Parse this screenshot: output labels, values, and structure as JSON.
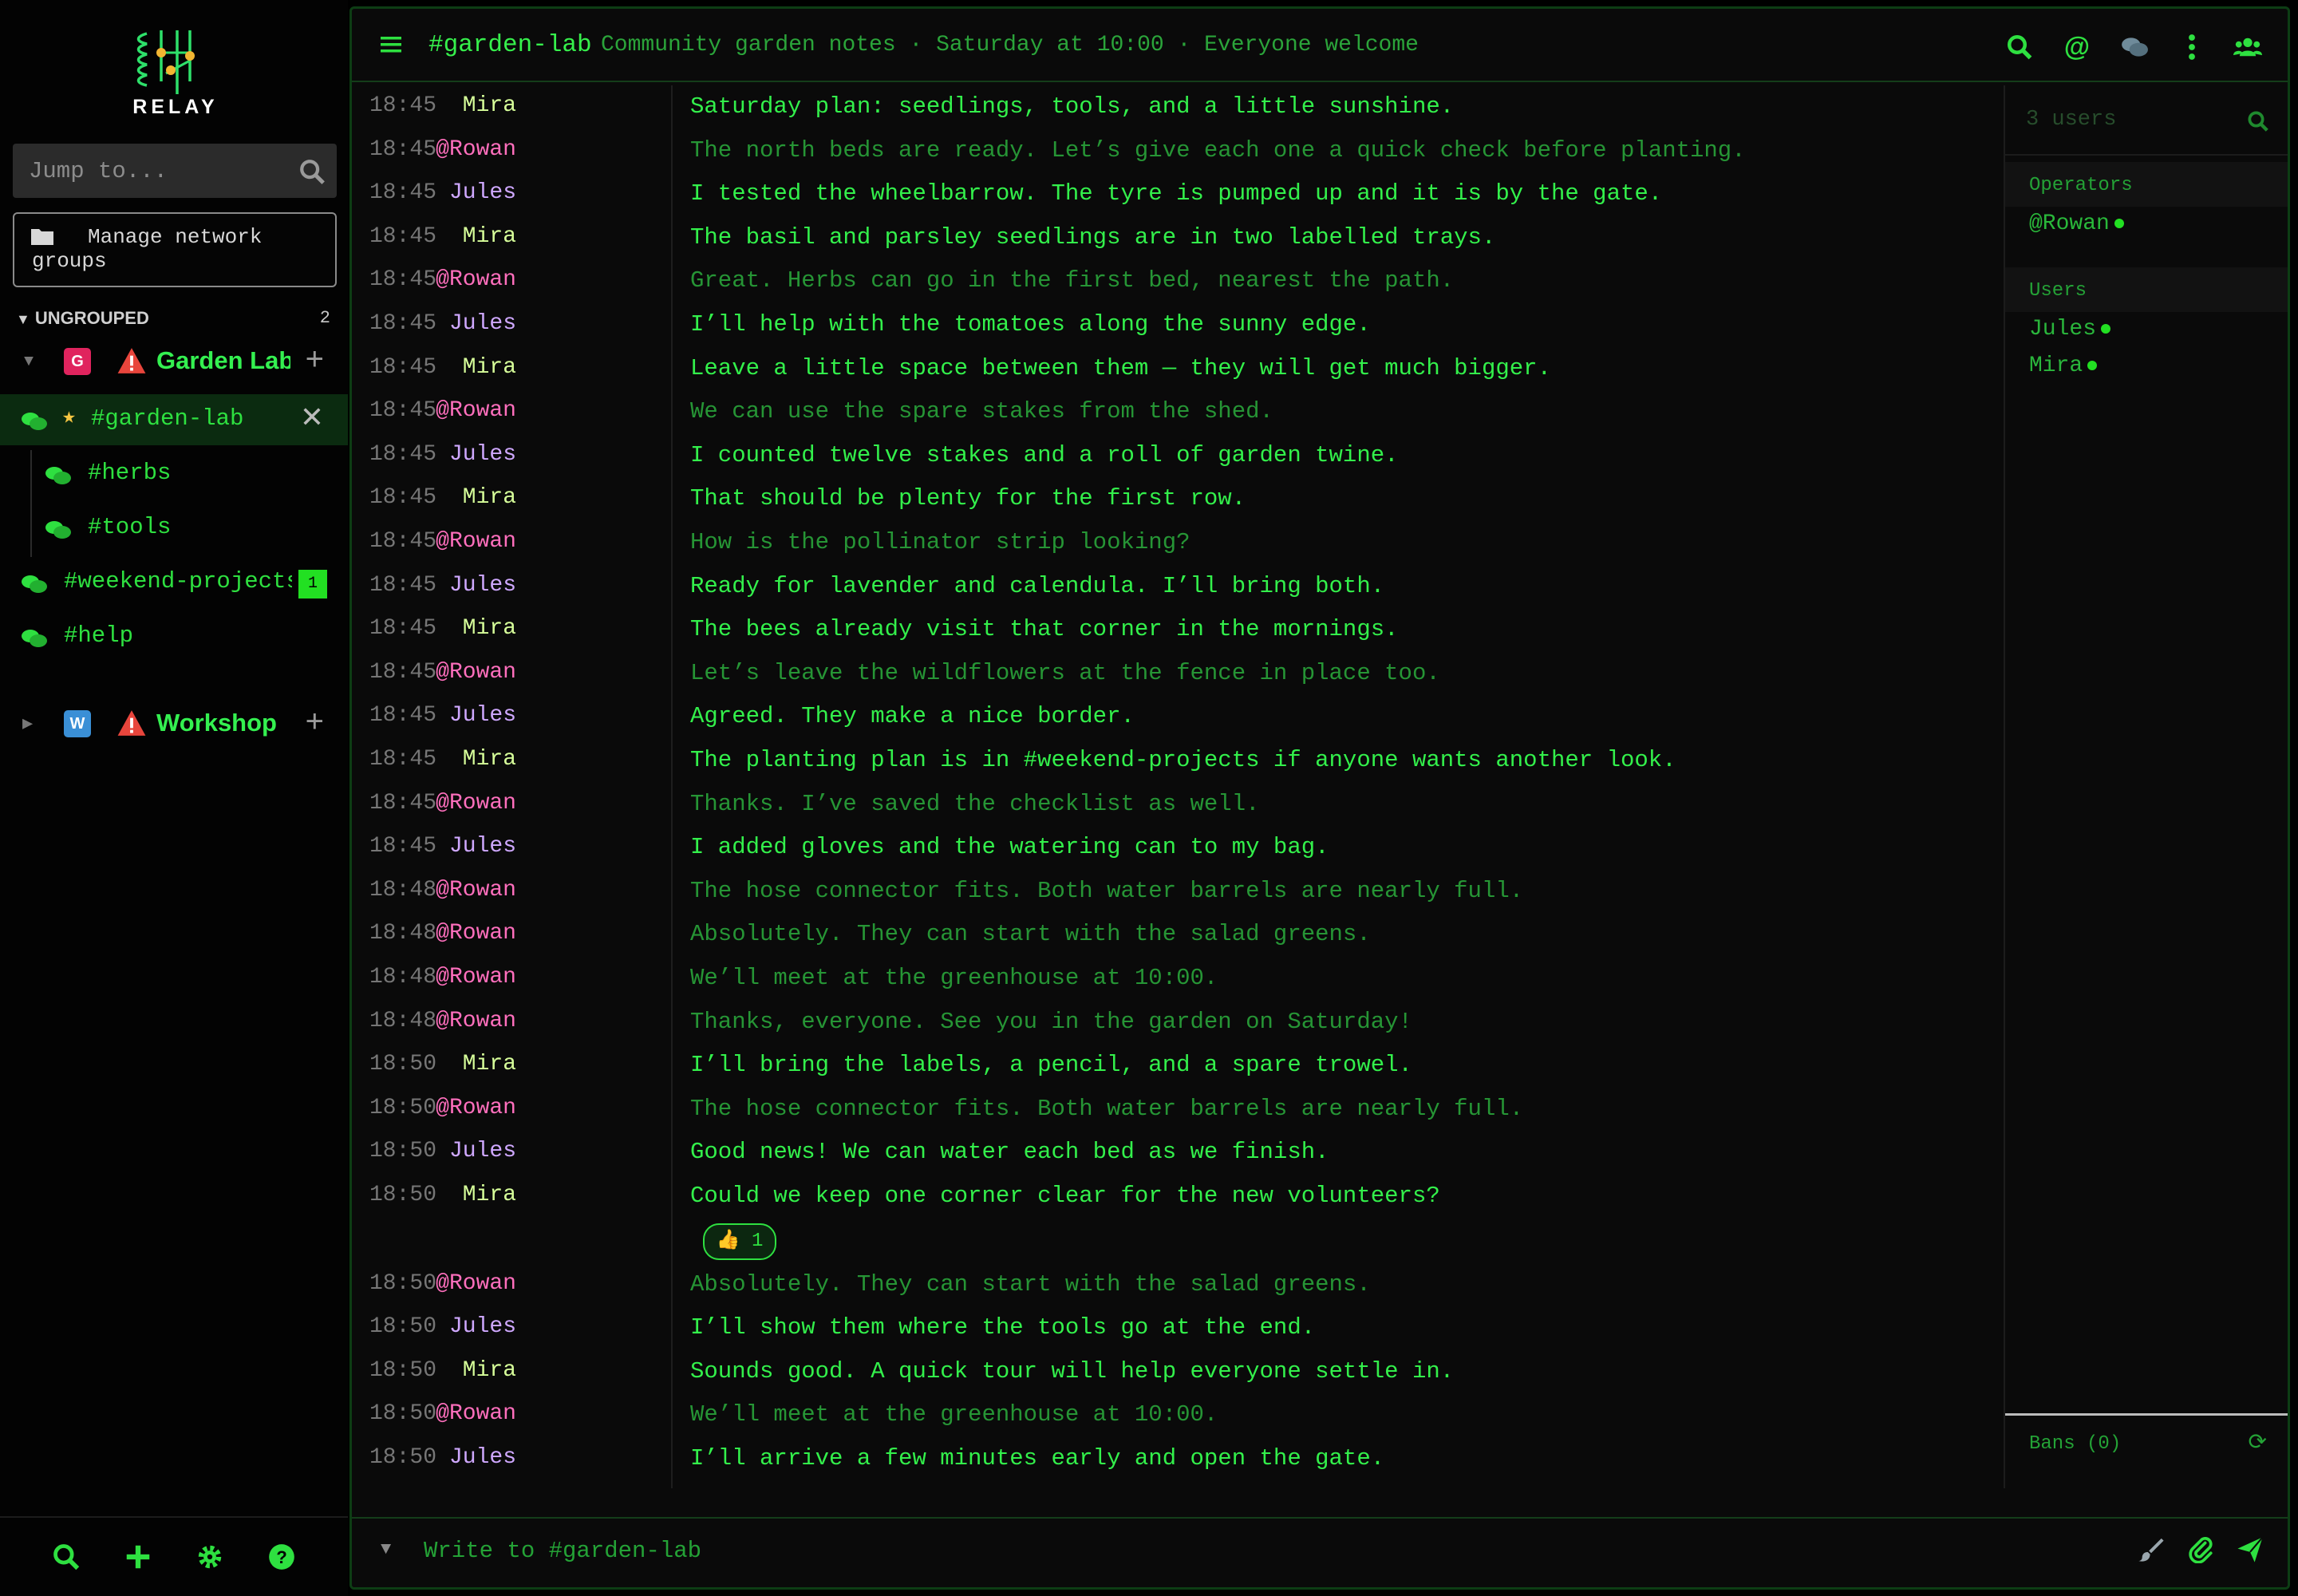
{
  "app": {
    "logo_text": "RELAY"
  },
  "sidebar": {
    "jump_placeholder": "Jump to...",
    "manage_label": "Manage network groups",
    "ungrouped_label": "UNGROUPED",
    "ungrouped_count": "2",
    "networks": [
      {
        "badge": "G",
        "badge_color": "#e0245e",
        "name": "Garden Lab",
        "channels": [
          {
            "name": "#garden-lab",
            "active": true,
            "starred": true
          },
          {
            "name": "#herbs"
          },
          {
            "name": "#tools"
          },
          {
            "name": "#weekend-projects",
            "unread": "1"
          },
          {
            "name": "#help"
          }
        ]
      },
      {
        "badge": "W",
        "badge_color": "#3a8fd6",
        "name": "Workshop"
      }
    ]
  },
  "header": {
    "channel": "#garden-lab",
    "topic": "Community garden notes · Saturday at 10:00 · Everyone welcome"
  },
  "messages": [
    {
      "time": "18:45",
      "nick": "Mira",
      "text": "Saturday plan: seedlings, tools, and a little sunshine."
    },
    {
      "time": "18:45",
      "nick": "@Rowan",
      "text": "The north beds are ready. Let’s give each one a quick check before planting."
    },
    {
      "time": "18:45",
      "nick": "Jules",
      "text": "I tested the wheelbarrow. The tyre is pumped up and it is by the gate."
    },
    {
      "time": "18:45",
      "nick": "Mira",
      "text": "The basil and parsley seedlings are in two labelled trays."
    },
    {
      "time": "18:45",
      "nick": "@Rowan",
      "text": "Great. Herbs can go in the first bed, nearest the path."
    },
    {
      "time": "18:45",
      "nick": "Jules",
      "text": "I’ll help with the tomatoes along the sunny edge."
    },
    {
      "time": "18:45",
      "nick": "Mira",
      "text": "Leave a little space between them — they will get much bigger."
    },
    {
      "time": "18:45",
      "nick": "@Rowan",
      "text": "We can use the spare stakes from the shed."
    },
    {
      "time": "18:45",
      "nick": "Jules",
      "text": "I counted twelve stakes and a roll of garden twine."
    },
    {
      "time": "18:45",
      "nick": "Mira",
      "text": "That should be plenty for the first row."
    },
    {
      "time": "18:45",
      "nick": "@Rowan",
      "text": "How is the pollinator strip looking?"
    },
    {
      "time": "18:45",
      "nick": "Jules",
      "text": "Ready for lavender and calendula. I’ll bring both."
    },
    {
      "time": "18:45",
      "nick": "Mira",
      "text": "The bees already visit that corner in the mornings."
    },
    {
      "time": "18:45",
      "nick": "@Rowan",
      "text": "Let’s leave the wildflowers at the fence in place too."
    },
    {
      "time": "18:45",
      "nick": "Jules",
      "text": "Agreed. They make a nice border."
    },
    {
      "time": "18:45",
      "nick": "Mira",
      "text": "The planting plan is in #weekend-projects if anyone wants another look."
    },
    {
      "time": "18:45",
      "nick": "@Rowan",
      "text": "Thanks. I’ve saved the checklist as well."
    },
    {
      "time": "18:45",
      "nick": "Jules",
      "text": "I added gloves and the watering can to my bag."
    },
    {
      "time": "18:48",
      "nick": "@Rowan",
      "text": "The hose connector fits. Both water barrels are nearly full."
    },
    {
      "time": "18:48",
      "nick": "@Rowan",
      "text": "Absolutely. They can start with the salad greens."
    },
    {
      "time": "18:48",
      "nick": "@Rowan",
      "text": "We’ll meet at the greenhouse at 10:00."
    },
    {
      "time": "18:48",
      "nick": "@Rowan",
      "text": "Thanks, everyone. See you in the garden on Saturday!"
    },
    {
      "time": "18:50",
      "nick": "Mira",
      "text": "I’ll bring the labels, a pencil, and a spare trowel."
    },
    {
      "time": "18:50",
      "nick": "@Rowan",
      "text": "The hose connector fits. Both water barrels are nearly full."
    },
    {
      "time": "18:50",
      "nick": "Jules",
      "text": "Good news! We can water each bed as we finish."
    },
    {
      "time": "18:50",
      "nick": "Mira",
      "text": "Could we keep one corner clear for the new volunteers?"
    },
    {
      "time": "18:50",
      "nick": "@Rowan",
      "text": "Absolutely. They can start with the salad greens."
    },
    {
      "time": "18:50",
      "nick": "Jules",
      "text": "I’ll show them where the tools go at the end."
    },
    {
      "time": "18:50",
      "nick": "Mira",
      "text": "Sounds good. A quick tour will help everyone settle in."
    },
    {
      "time": "18:50",
      "nick": "@Rowan",
      "text": "We’ll meet at the greenhouse at 10:00."
    },
    {
      "time": "18:50",
      "nick": "Jules",
      "text": "I’ll arrive a few minutes early and open the gate."
    }
  ],
  "reaction": {
    "emoji": "👍",
    "count": "1"
  },
  "users_panel": {
    "count_placeholder": "3 users",
    "operators_label": "Operators",
    "operators": [
      "@Rowan"
    ],
    "users_label": "Users",
    "users": [
      "Jules",
      "Mira"
    ],
    "bans_label": "Bans (0)"
  },
  "composer": {
    "placeholder": "Write to #garden-lab"
  },
  "colors": {
    "accent": "#2ee040",
    "nick_mira": "#d7ff9a",
    "nick_jules": "#cfa8ff",
    "nick_rowan": "#ff6fbd"
  }
}
